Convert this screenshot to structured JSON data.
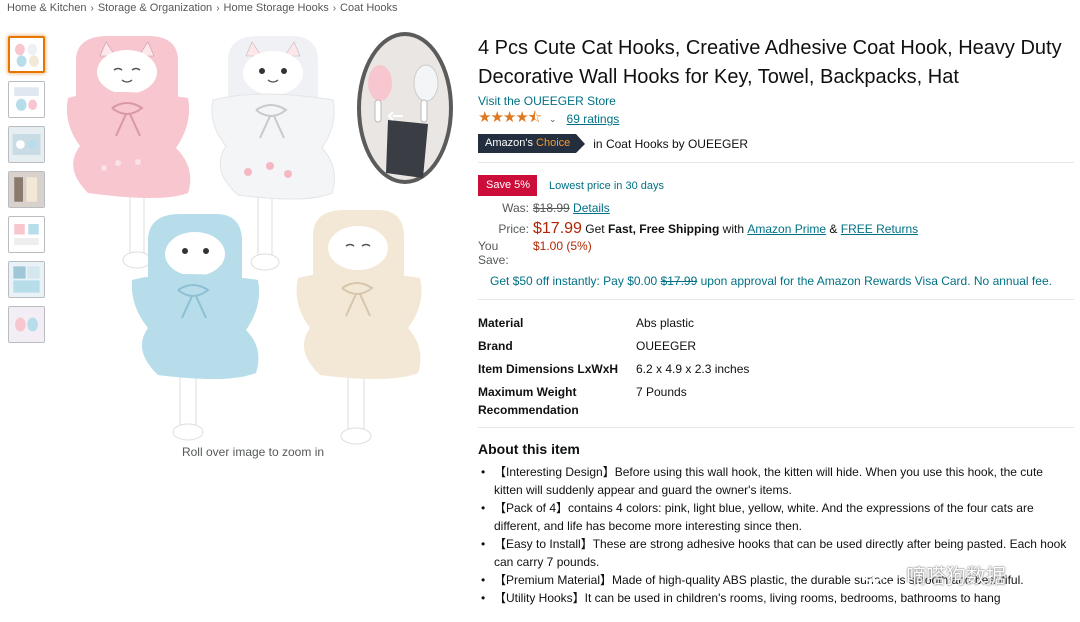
{
  "breadcrumb": [
    "Home & Kitchen",
    "Storage & Organization",
    "Home Storage Hooks",
    "Coat Hooks"
  ],
  "breadcrumb_sep": "›",
  "gallery": {
    "thumbnails": 7,
    "zoom_hint": "Roll over image to zoom in"
  },
  "product": {
    "title": "4 Pcs Cute Cat Hooks, Creative Adhesive Coat Hook, Heavy Duty Decorative Wall Hooks for Key, Towel, Backpacks, Hat",
    "store_link": "Visit the OUEEGER Store",
    "stars": "★★★★⯪",
    "rating_fraction": 0.9,
    "ratings_count": "69 ratings",
    "choice_badge_prefix": "Amazon's",
    "choice_badge_suffix": "Choice",
    "choice_text": "in Coat Hooks by OUEEGER"
  },
  "deal": {
    "save_badge": "Save 5%",
    "lowest_text": "Lowest price in 30 days"
  },
  "pricing": {
    "was_label": "Was:",
    "was_price": "$18.99",
    "details_link": "Details",
    "price_label": "Price:",
    "price": "$17.99",
    "shipping_pre": "Get",
    "shipping_bold": "Fast, Free Shipping",
    "shipping_with": "with",
    "prime_link": "Amazon Prime",
    "amp": "&",
    "returns_link": "FREE Returns",
    "save_label": "You Save:",
    "save_value": "$1.00 (5%)"
  },
  "visa": {
    "pre": "Get $50 off instantly: Pay $0.00",
    "strike": "$17.99",
    "post": "upon approval for the Amazon Rewards Visa Card. No annual fee."
  },
  "specs": [
    {
      "key": "Material",
      "value": "Abs plastic"
    },
    {
      "key": "Brand",
      "value": "OUEEGER"
    },
    {
      "key": "Item Dimensions LxWxH",
      "value": "6.2 x 4.9 x 2.3 inches"
    },
    {
      "key": "Maximum Weight Recommendation",
      "value": "7 Pounds"
    }
  ],
  "about": {
    "title": "About this item",
    "bullets": [
      "【Interesting Design】Before using this wall hook, the kitten will hide. When you use this hook, the cute kitten will suddenly appear and guard the owner's items.",
      "【Pack of 4】contains 4 colors: pink, light blue, yellow, white. And the expressions of the four cats are different, and life has become more interesting since then.",
      "【Easy to Install】These are strong adhesive hooks that can be used directly after being pasted. Each hook can carry 7 pounds.",
      "【Premium Material】Made of high-quality ABS plastic, the durable surface is smooth and beautiful.",
      "【Utility Hooks】It can be used in children's rooms, living rooms, bedrooms, bathrooms to hang"
    ]
  },
  "watermark": "嘀嗒狗数据",
  "colors": {
    "link": "#007185",
    "price": "#B12704",
    "save_badge": "#CC0C39",
    "star": "#DE7921",
    "choice_badge": "#232F3E",
    "hook_pink": "#F7C6CF",
    "hook_white": "#F4F5F7",
    "hook_blue": "#B7DDEB",
    "hook_cream": "#F3E8D6"
  }
}
